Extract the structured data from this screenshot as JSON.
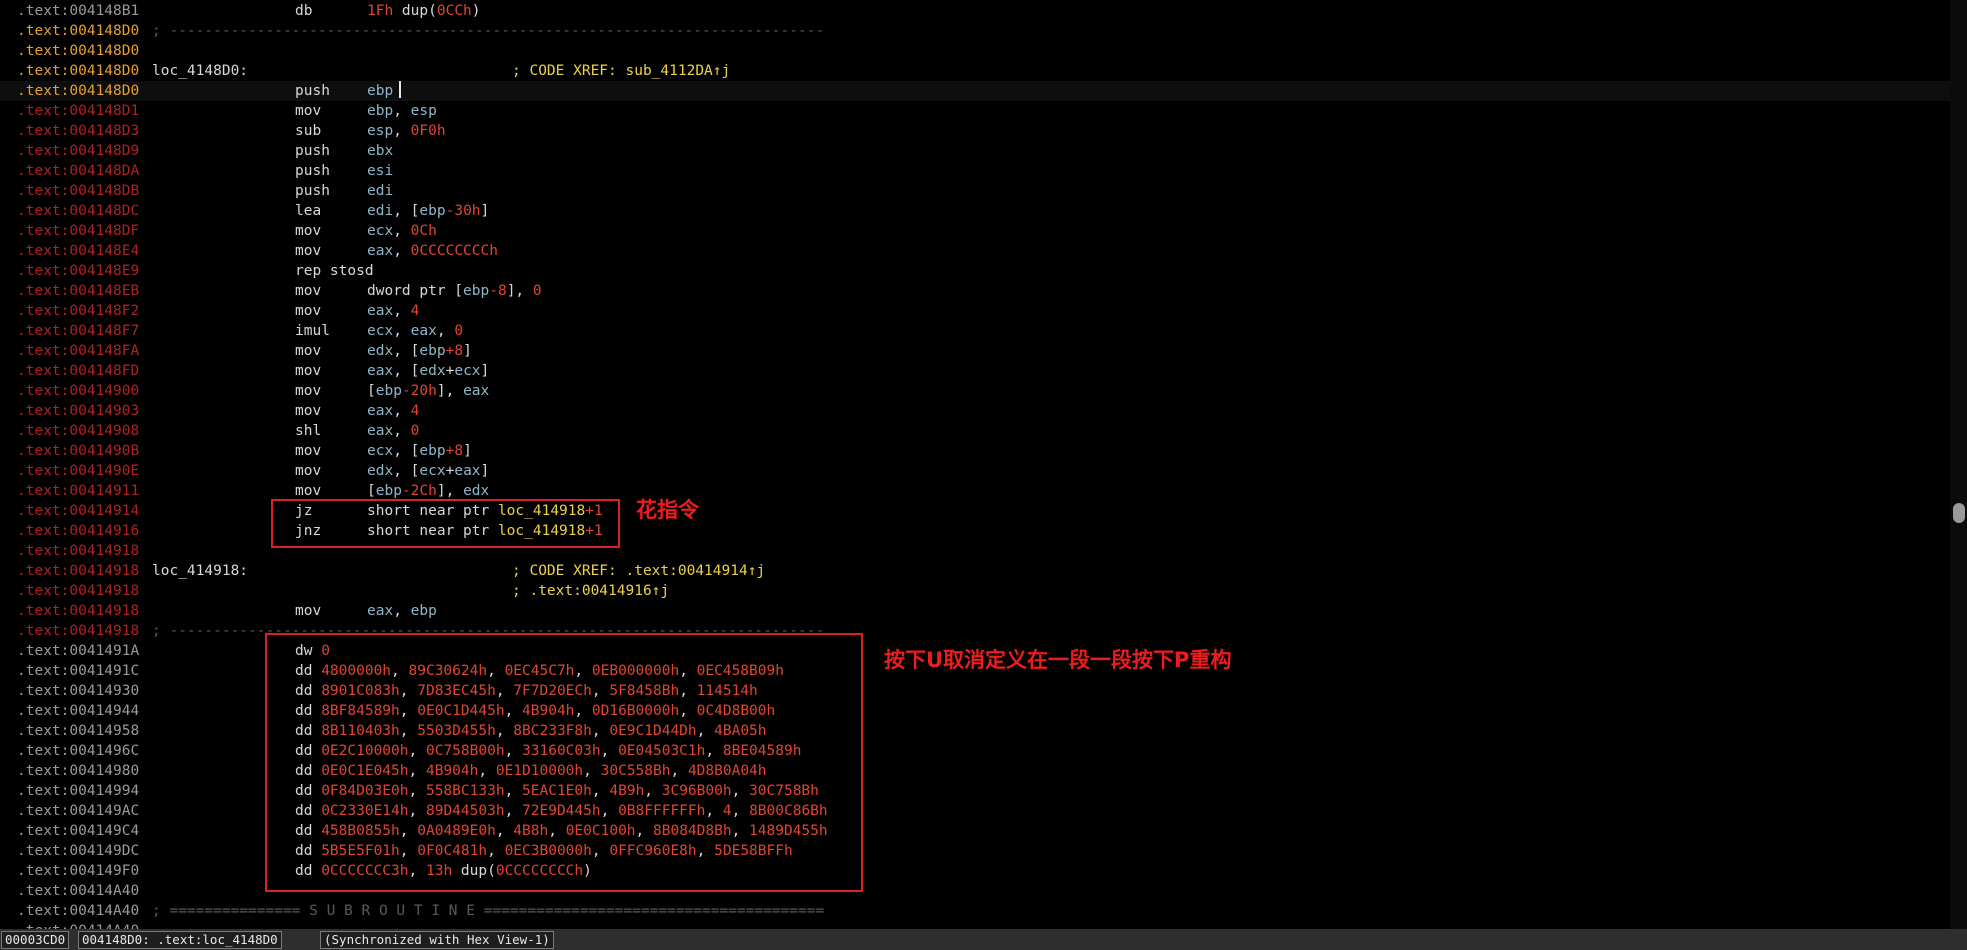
{
  "colors": {
    "background": "#000000",
    "address_data": "#9a9a9a",
    "address_code": "#b02222",
    "address_label": "#e8a030",
    "register": "#8fb6c8",
    "number": "#e0462f",
    "name": "#eed045",
    "comment": "#ecd24a",
    "annotation": "#ee1c1c"
  },
  "lines": [
    {
      "addr": ".text:004148B1",
      "at": "data",
      "mnem": "db",
      "tok": [
        {
          "t": "1Fh",
          "c": "num"
        },
        {
          "t": " dup(",
          "c": "plain"
        },
        {
          "t": "0CCh",
          "c": "num"
        },
        {
          "t": ")",
          "c": "plain"
        }
      ]
    },
    {
      "addr": ".text:004148D0",
      "at": "label",
      "sep": "; ---------------------------------------------------------------------------"
    },
    {
      "addr": ".text:004148D0",
      "at": "label"
    },
    {
      "addr": ".text:004148D0",
      "at": "label",
      "label": "loc_4148D0:",
      "cmt": "; CODE XREF: sub_4112DA↑j"
    },
    {
      "addr": ".text:004148D0",
      "at": "label",
      "mnem": "push",
      "tok": [
        {
          "t": "ebp",
          "c": "reg"
        }
      ],
      "current": true
    },
    {
      "addr": ".text:004148D1",
      "at": "code",
      "mnem": "mov",
      "tok": [
        {
          "t": "ebp",
          "c": "reg"
        },
        {
          "t": ", ",
          "c": "plain"
        },
        {
          "t": "esp",
          "c": "reg"
        }
      ]
    },
    {
      "addr": ".text:004148D3",
      "at": "code",
      "mnem": "sub",
      "tok": [
        {
          "t": "esp",
          "c": "reg"
        },
        {
          "t": ", ",
          "c": "plain"
        },
        {
          "t": "0F0h",
          "c": "num"
        }
      ]
    },
    {
      "addr": ".text:004148D9",
      "at": "code",
      "mnem": "push",
      "tok": [
        {
          "t": "ebx",
          "c": "reg"
        }
      ]
    },
    {
      "addr": ".text:004148DA",
      "at": "code",
      "mnem": "push",
      "tok": [
        {
          "t": "esi",
          "c": "reg"
        }
      ]
    },
    {
      "addr": ".text:004148DB",
      "at": "code",
      "mnem": "push",
      "tok": [
        {
          "t": "edi",
          "c": "reg"
        }
      ]
    },
    {
      "addr": ".text:004148DC",
      "at": "code",
      "mnem": "lea",
      "tok": [
        {
          "t": "edi",
          "c": "reg"
        },
        {
          "t": ", [",
          "c": "plain"
        },
        {
          "t": "ebp",
          "c": "reg"
        },
        {
          "t": "-30h",
          "c": "num"
        },
        {
          "t": "]",
          "c": "plain"
        }
      ]
    },
    {
      "addr": ".text:004148DF",
      "at": "code",
      "mnem": "mov",
      "tok": [
        {
          "t": "ecx",
          "c": "reg"
        },
        {
          "t": ", ",
          "c": "plain"
        },
        {
          "t": "0Ch",
          "c": "num"
        }
      ]
    },
    {
      "addr": ".text:004148E4",
      "at": "code",
      "mnem": "mov",
      "tok": [
        {
          "t": "eax",
          "c": "reg"
        },
        {
          "t": ", ",
          "c": "plain"
        },
        {
          "t": "0CCCCCCCCh",
          "c": "num"
        }
      ]
    },
    {
      "addr": ".text:004148E9",
      "at": "code",
      "mnem": "rep stosd",
      "tok": []
    },
    {
      "addr": ".text:004148EB",
      "at": "code",
      "mnem": "mov",
      "tok": [
        {
          "t": "dword ptr [",
          "c": "plain"
        },
        {
          "t": "ebp",
          "c": "reg"
        },
        {
          "t": "-8",
          "c": "num"
        },
        {
          "t": "], ",
          "c": "plain"
        },
        {
          "t": "0",
          "c": "num"
        }
      ]
    },
    {
      "addr": ".text:004148F2",
      "at": "code",
      "mnem": "mov",
      "tok": [
        {
          "t": "eax",
          "c": "reg"
        },
        {
          "t": ", ",
          "c": "plain"
        },
        {
          "t": "4",
          "c": "num"
        }
      ]
    },
    {
      "addr": ".text:004148F7",
      "at": "code",
      "mnem": "imul",
      "tok": [
        {
          "t": "ecx",
          "c": "reg"
        },
        {
          "t": ", ",
          "c": "plain"
        },
        {
          "t": "eax",
          "c": "reg"
        },
        {
          "t": ", ",
          "c": "plain"
        },
        {
          "t": "0",
          "c": "num"
        }
      ]
    },
    {
      "addr": ".text:004148FA",
      "at": "code",
      "mnem": "mov",
      "tok": [
        {
          "t": "edx",
          "c": "reg"
        },
        {
          "t": ", [",
          "c": "plain"
        },
        {
          "t": "ebp",
          "c": "reg"
        },
        {
          "t": "+8",
          "c": "num"
        },
        {
          "t": "]",
          "c": "plain"
        }
      ]
    },
    {
      "addr": ".text:004148FD",
      "at": "code",
      "mnem": "mov",
      "tok": [
        {
          "t": "eax",
          "c": "reg"
        },
        {
          "t": ", [",
          "c": "plain"
        },
        {
          "t": "edx",
          "c": "reg"
        },
        {
          "t": "+",
          "c": "plain"
        },
        {
          "t": "ecx",
          "c": "reg"
        },
        {
          "t": "]",
          "c": "plain"
        }
      ]
    },
    {
      "addr": ".text:00414900",
      "at": "code",
      "mnem": "mov",
      "tok": [
        {
          "t": "[",
          "c": "plain"
        },
        {
          "t": "ebp",
          "c": "reg"
        },
        {
          "t": "-20h",
          "c": "num"
        },
        {
          "t": "], ",
          "c": "plain"
        },
        {
          "t": "eax",
          "c": "reg"
        }
      ]
    },
    {
      "addr": ".text:00414903",
      "at": "code",
      "mnem": "mov",
      "tok": [
        {
          "t": "eax",
          "c": "reg"
        },
        {
          "t": ", ",
          "c": "plain"
        },
        {
          "t": "4",
          "c": "num"
        }
      ]
    },
    {
      "addr": ".text:00414908",
      "at": "code",
      "mnem": "shl",
      "tok": [
        {
          "t": "eax",
          "c": "reg"
        },
        {
          "t": ", ",
          "c": "plain"
        },
        {
          "t": "0",
          "c": "num"
        }
      ]
    },
    {
      "addr": ".text:0041490B",
      "at": "code",
      "mnem": "mov",
      "tok": [
        {
          "t": "ecx",
          "c": "reg"
        },
        {
          "t": ", [",
          "c": "plain"
        },
        {
          "t": "ebp",
          "c": "reg"
        },
        {
          "t": "+8",
          "c": "num"
        },
        {
          "t": "]",
          "c": "plain"
        }
      ]
    },
    {
      "addr": ".text:0041490E",
      "at": "code",
      "mnem": "mov",
      "tok": [
        {
          "t": "edx",
          "c": "reg"
        },
        {
          "t": ", [",
          "c": "plain"
        },
        {
          "t": "ecx",
          "c": "reg"
        },
        {
          "t": "+",
          "c": "plain"
        },
        {
          "t": "eax",
          "c": "reg"
        },
        {
          "t": "]",
          "c": "plain"
        }
      ]
    },
    {
      "addr": ".text:00414911",
      "at": "code",
      "mnem": "mov",
      "tok": [
        {
          "t": "[",
          "c": "plain"
        },
        {
          "t": "ebp",
          "c": "reg"
        },
        {
          "t": "-2Ch",
          "c": "num"
        },
        {
          "t": "], ",
          "c": "plain"
        },
        {
          "t": "edx",
          "c": "reg"
        }
      ]
    },
    {
      "addr": ".text:00414914",
      "at": "code",
      "mnem": "jz",
      "tok": [
        {
          "t": "short near ptr ",
          "c": "plain"
        },
        {
          "t": "loc_414918",
          "c": "name"
        },
        {
          "t": "+1",
          "c": "num"
        }
      ]
    },
    {
      "addr": ".text:00414916",
      "at": "code",
      "mnem": "jnz",
      "tok": [
        {
          "t": "short near ptr ",
          "c": "plain"
        },
        {
          "t": "loc_414918",
          "c": "name"
        },
        {
          "t": "+1",
          "c": "num"
        }
      ]
    },
    {
      "addr": ".text:00414918",
      "at": "code"
    },
    {
      "addr": ".text:00414918",
      "at": "code",
      "label": "loc_414918:",
      "cmt": "; CODE XREF: .text:00414914↑j"
    },
    {
      "addr": ".text:00414918",
      "at": "code",
      "cmt": "; .text:00414916↑j"
    },
    {
      "addr": ".text:00414918",
      "at": "code",
      "mnem": "mov",
      "tok": [
        {
          "t": "eax",
          "c": "reg"
        },
        {
          "t": ", ",
          "c": "plain"
        },
        {
          "t": "ebp",
          "c": "reg"
        }
      ]
    },
    {
      "addr": ".text:00414918",
      "at": "code",
      "sep": "; ---------------------------------------------------------------------------"
    },
    {
      "addr": ".text:0041491A",
      "at": "data",
      "dd": [
        {
          "t": "dw ",
          "c": "plain"
        },
        {
          "t": "0",
          "c": "num"
        }
      ]
    },
    {
      "addr": ".text:0041491C",
      "at": "data",
      "dd": [
        {
          "t": "dd ",
          "c": "plain"
        },
        {
          "t": "4800000h",
          "c": "num"
        },
        {
          "t": ", ",
          "c": "plain"
        },
        {
          "t": "89C30624h",
          "c": "num"
        },
        {
          "t": ", ",
          "c": "plain"
        },
        {
          "t": "0EC45C7h",
          "c": "num"
        },
        {
          "t": ", ",
          "c": "plain"
        },
        {
          "t": "0EB000000h",
          "c": "num"
        },
        {
          "t": ", ",
          "c": "plain"
        },
        {
          "t": "0EC458B09h",
          "c": "num"
        }
      ]
    },
    {
      "addr": ".text:00414930",
      "at": "data",
      "dd": [
        {
          "t": "dd ",
          "c": "plain"
        },
        {
          "t": "8901C083h",
          "c": "num"
        },
        {
          "t": ", ",
          "c": "plain"
        },
        {
          "t": "7D83EC45h",
          "c": "num"
        },
        {
          "t": ", ",
          "c": "plain"
        },
        {
          "t": "7F7D20ECh",
          "c": "num"
        },
        {
          "t": ", ",
          "c": "plain"
        },
        {
          "t": "5F8458Bh",
          "c": "num"
        },
        {
          "t": ", ",
          "c": "plain"
        },
        {
          "t": "114514h",
          "c": "num"
        }
      ]
    },
    {
      "addr": ".text:00414944",
      "at": "data",
      "dd": [
        {
          "t": "dd ",
          "c": "plain"
        },
        {
          "t": "8BF84589h",
          "c": "num"
        },
        {
          "t": ", ",
          "c": "plain"
        },
        {
          "t": "0E0C1D445h",
          "c": "num"
        },
        {
          "t": ", ",
          "c": "plain"
        },
        {
          "t": "4B904h",
          "c": "num"
        },
        {
          "t": ", ",
          "c": "plain"
        },
        {
          "t": "0D16B0000h",
          "c": "num"
        },
        {
          "t": ", ",
          "c": "plain"
        },
        {
          "t": "0C4D8B00h",
          "c": "num"
        }
      ]
    },
    {
      "addr": ".text:00414958",
      "at": "data",
      "dd": [
        {
          "t": "dd ",
          "c": "plain"
        },
        {
          "t": "8B110403h",
          "c": "num"
        },
        {
          "t": ", ",
          "c": "plain"
        },
        {
          "t": "5503D455h",
          "c": "num"
        },
        {
          "t": ", ",
          "c": "plain"
        },
        {
          "t": "8BC233F8h",
          "c": "num"
        },
        {
          "t": ", ",
          "c": "plain"
        },
        {
          "t": "0E9C1D44Dh",
          "c": "num"
        },
        {
          "t": ", ",
          "c": "plain"
        },
        {
          "t": "4BA05h",
          "c": "num"
        }
      ]
    },
    {
      "addr": ".text:0041496C",
      "at": "data",
      "dd": [
        {
          "t": "dd ",
          "c": "plain"
        },
        {
          "t": "0E2C10000h",
          "c": "num"
        },
        {
          "t": ", ",
          "c": "plain"
        },
        {
          "t": "0C758B00h",
          "c": "num"
        },
        {
          "t": ", ",
          "c": "plain"
        },
        {
          "t": "33160C03h",
          "c": "num"
        },
        {
          "t": ", ",
          "c": "plain"
        },
        {
          "t": "0E04503C1h",
          "c": "num"
        },
        {
          "t": ", ",
          "c": "plain"
        },
        {
          "t": "8BE04589h",
          "c": "num"
        }
      ]
    },
    {
      "addr": ".text:00414980",
      "at": "data",
      "dd": [
        {
          "t": "dd ",
          "c": "plain"
        },
        {
          "t": "0E0C1E045h",
          "c": "num"
        },
        {
          "t": ", ",
          "c": "plain"
        },
        {
          "t": "4B904h",
          "c": "num"
        },
        {
          "t": ", ",
          "c": "plain"
        },
        {
          "t": "0E1D10000h",
          "c": "num"
        },
        {
          "t": ", ",
          "c": "plain"
        },
        {
          "t": "30C558Bh",
          "c": "num"
        },
        {
          "t": ", ",
          "c": "plain"
        },
        {
          "t": "4D8B0A04h",
          "c": "num"
        }
      ]
    },
    {
      "addr": ".text:00414994",
      "at": "data",
      "dd": [
        {
          "t": "dd ",
          "c": "plain"
        },
        {
          "t": "0F84D03E0h",
          "c": "num"
        },
        {
          "t": ", ",
          "c": "plain"
        },
        {
          "t": "558BC133h",
          "c": "num"
        },
        {
          "t": ", ",
          "c": "plain"
        },
        {
          "t": "5EAC1E0h",
          "c": "num"
        },
        {
          "t": ", ",
          "c": "plain"
        },
        {
          "t": "4B9h",
          "c": "num"
        },
        {
          "t": ", ",
          "c": "plain"
        },
        {
          "t": "3C96B00h",
          "c": "num"
        },
        {
          "t": ", ",
          "c": "plain"
        },
        {
          "t": "30C758Bh",
          "c": "num"
        }
      ]
    },
    {
      "addr": ".text:004149AC",
      "at": "data",
      "dd": [
        {
          "t": "dd ",
          "c": "plain"
        },
        {
          "t": "0C2330E14h",
          "c": "num"
        },
        {
          "t": ", ",
          "c": "plain"
        },
        {
          "t": "89D44503h",
          "c": "num"
        },
        {
          "t": ", ",
          "c": "plain"
        },
        {
          "t": "72E9D445h",
          "c": "num"
        },
        {
          "t": ", ",
          "c": "plain"
        },
        {
          "t": "0B8FFFFFFh",
          "c": "num"
        },
        {
          "t": ", ",
          "c": "plain"
        },
        {
          "t": "4",
          "c": "num"
        },
        {
          "t": ", ",
          "c": "plain"
        },
        {
          "t": "8B00C86Bh",
          "c": "num"
        }
      ]
    },
    {
      "addr": ".text:004149C4",
      "at": "data",
      "dd": [
        {
          "t": "dd ",
          "c": "plain"
        },
        {
          "t": "458B0855h",
          "c": "num"
        },
        {
          "t": ", ",
          "c": "plain"
        },
        {
          "t": "0A0489E0h",
          "c": "num"
        },
        {
          "t": ", ",
          "c": "plain"
        },
        {
          "t": "4B8h",
          "c": "num"
        },
        {
          "t": ", ",
          "c": "plain"
        },
        {
          "t": "0E0C100h",
          "c": "num"
        },
        {
          "t": ", ",
          "c": "plain"
        },
        {
          "t": "8B084D8Bh",
          "c": "num"
        },
        {
          "t": ", ",
          "c": "plain"
        },
        {
          "t": "1489D455h",
          "c": "num"
        }
      ]
    },
    {
      "addr": ".text:004149DC",
      "at": "data",
      "dd": [
        {
          "t": "dd ",
          "c": "plain"
        },
        {
          "t": "5B5E5F01h",
          "c": "num"
        },
        {
          "t": ", ",
          "c": "plain"
        },
        {
          "t": "0F0C481h",
          "c": "num"
        },
        {
          "t": ", ",
          "c": "plain"
        },
        {
          "t": "0EC3B0000h",
          "c": "num"
        },
        {
          "t": ", ",
          "c": "plain"
        },
        {
          "t": "0FFC960E8h",
          "c": "num"
        },
        {
          "t": ", ",
          "c": "plain"
        },
        {
          "t": "5DE58BFFh",
          "c": "num"
        }
      ]
    },
    {
      "addr": ".text:004149F0",
      "at": "data",
      "dd": [
        {
          "t": "dd ",
          "c": "plain"
        },
        {
          "t": "0CCCCCCC3h",
          "c": "num"
        },
        {
          "t": ", ",
          "c": "plain"
        },
        {
          "t": "13h",
          "c": "num"
        },
        {
          "t": " dup(",
          "c": "plain"
        },
        {
          "t": "0CCCCCCCCh",
          "c": "num"
        },
        {
          "t": ")",
          "c": "plain"
        }
      ]
    },
    {
      "addr": ".text:00414A40",
      "at": "data"
    },
    {
      "addr": ".text:00414A40",
      "at": "data",
      "sep": "; =============== S U B R O U T I N E ======================================="
    },
    {
      "addr": ".text:00414A40",
      "at": "data"
    }
  ],
  "annotations": {
    "junk_instructions": "花指令",
    "undefine_hint": "按下U取消定义在一段一段按下P重构"
  },
  "status": {
    "offset": "00003CD0",
    "location": "004148D0: .text:loc_4148D0",
    "sync": "(Synchronized with Hex View-1)"
  }
}
